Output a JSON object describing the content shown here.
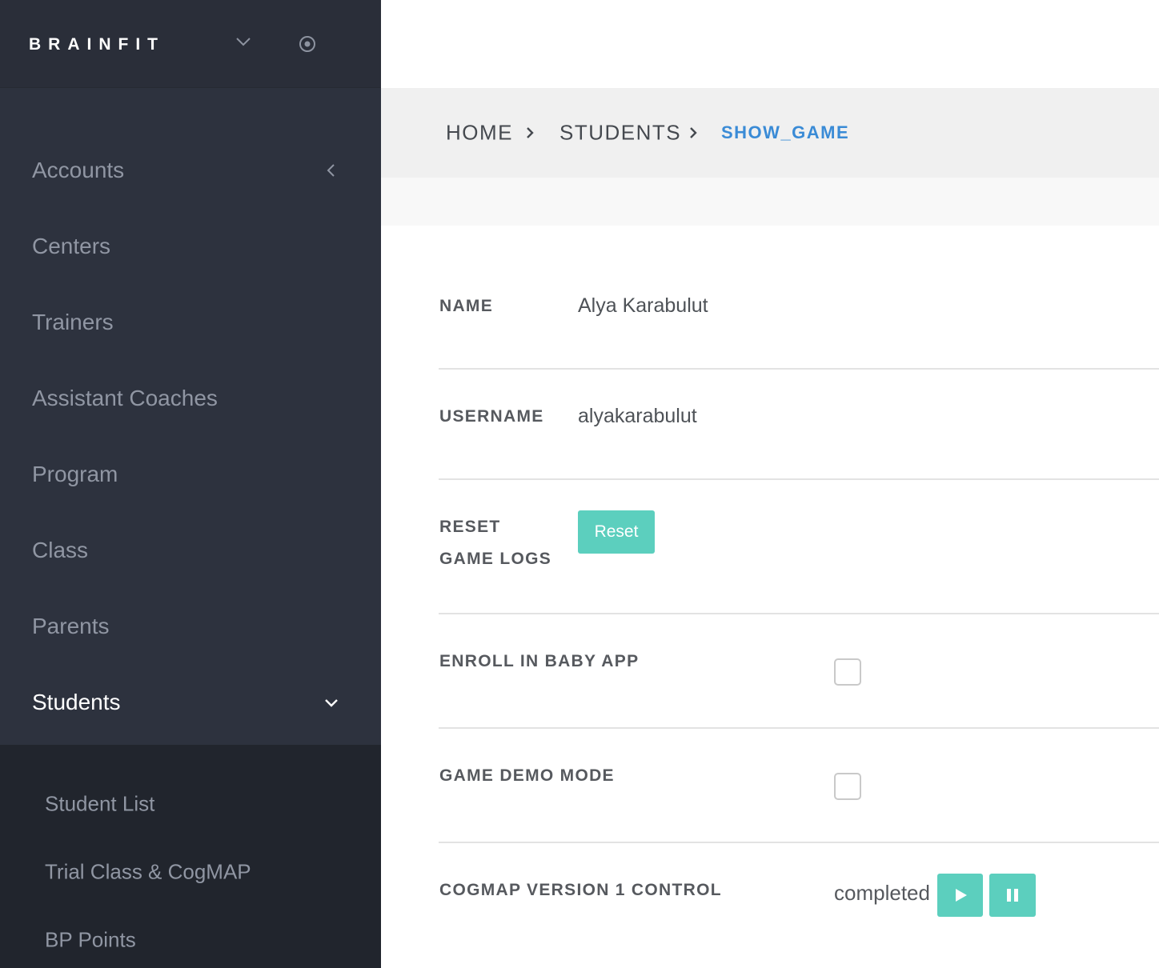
{
  "brand": {
    "logo_text": "BRAINFIT"
  },
  "icons": {
    "brand_dropdown": "chevron-down-icon",
    "brand_settings": "circle-dot-icon",
    "accounts_arrow": "chevron-left-icon",
    "students_arrow": "chevron-down-icon",
    "breadcrumb_sep": "chevron-right-icon",
    "play": "play-icon",
    "pause": "pause-icon"
  },
  "sidebar": {
    "items": [
      {
        "label": "Accounts"
      },
      {
        "label": "Centers"
      },
      {
        "label": "Trainers"
      },
      {
        "label": "Assistant Coaches"
      },
      {
        "label": "Program"
      },
      {
        "label": "Class"
      },
      {
        "label": "Parents"
      },
      {
        "label": "Students"
      }
    ],
    "active": "Students",
    "sub_items": [
      {
        "label": "Student List"
      },
      {
        "label": "Trial Class & CogMAP"
      },
      {
        "label": "BP Points"
      }
    ]
  },
  "breadcrumb": {
    "items": [
      "HOME",
      "STUDENTS",
      "SHOW_GAME"
    ]
  },
  "fields": {
    "name": {
      "label": "NAME",
      "value": "Alya Karabulut"
    },
    "username": {
      "label": "USERNAME",
      "value": "alyakarabulut"
    },
    "reset": {
      "label_line1": "RESET",
      "label_line2": "GAME LOGS",
      "button": "Reset"
    },
    "baby_app": {
      "label": "ENROLL IN BABY APP",
      "checked": false
    },
    "demo_mode": {
      "label": "GAME DEMO MODE",
      "checked": false
    },
    "cogmap": {
      "label": "COGMAP VERSION 1 CONTROL",
      "status": "completed"
    }
  },
  "colors": {
    "sidebar_bg": "#2d323e",
    "subnav_bg": "#21252d",
    "accent_teal": "#5ccfbe",
    "breadcrumb_active": "#3a8bd6"
  }
}
